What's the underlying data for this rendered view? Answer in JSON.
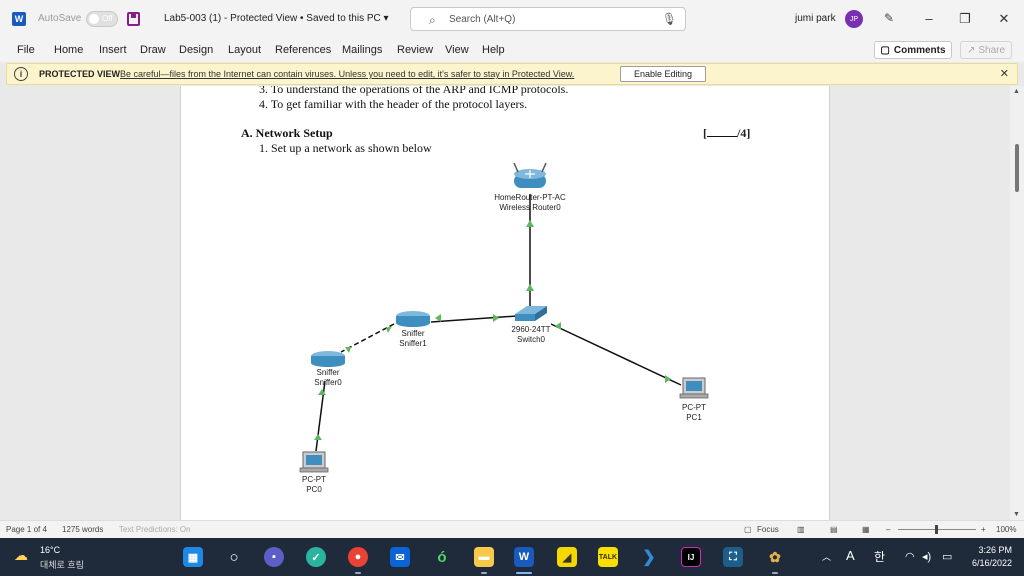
{
  "titlebar": {
    "app_logo": "W",
    "autosave_label": "AutoSave",
    "autosave_state": "Off",
    "doc_title": "Lab5-003 (1)  -  Protected View • Saved to this PC ▾",
    "search_placeholder": "Search (Alt+Q)",
    "user_name": "jumi park",
    "user_initials": "JP"
  },
  "menu": {
    "items": [
      "File",
      "Home",
      "Insert",
      "Draw",
      "Design",
      "Layout",
      "References",
      "Mailings",
      "Review",
      "View",
      "Help"
    ],
    "comments_label": "Comments",
    "share_label": "Share"
  },
  "protected_view": {
    "title": "PROTECTED VIEW",
    "message": "Be careful—files from the Internet can contain viruses. Unless you need to edit, it's safer to stay in Protected View.",
    "enable_button": "Enable Editing"
  },
  "document": {
    "line3": "3.   To understand the operations of the ARP and ICMP protocols.",
    "line4": "4.   To get familiar with the header of the protocol layers.",
    "section_heading": "A.  Network Setup",
    "score_suffix": "/4]",
    "score_prefix": "[",
    "step1": "1.   Set up a network as shown below"
  },
  "diagram": {
    "router_type": "HomeRouter-PT-AC",
    "router_name": "Wireless Router0",
    "switch_type": "2960-24TT",
    "switch_name": "Switch0",
    "sniffer1_type": "Sniffer",
    "sniffer1_name": "Sniffer1",
    "sniffer0_type": "Sniffer",
    "sniffer0_name": "Sniffer0",
    "pc1_type": "PC-PT",
    "pc1_name": "PC1",
    "pc0_type": "PC-PT",
    "pc0_name": "PC0",
    "link_color": "#111111",
    "port_up_color": "#5cb85c",
    "device_color": "#3e8fc0"
  },
  "statusbar": {
    "page": "Page 1 of 4",
    "words": "1275 words",
    "predictions": "Text Predictions: On",
    "focus": "Focus",
    "zoom": "100%"
  },
  "taskbar": {
    "temperature": "16°C",
    "condition": "대체로 흐림",
    "time": "3:26 PM",
    "date": "6/16/2022",
    "lang": "A",
    "ime": "한"
  },
  "colors": {
    "word_blue": "#185abd",
    "protected_bg": "#fcf4cc",
    "taskbar_bg": "#1f2a3a"
  }
}
